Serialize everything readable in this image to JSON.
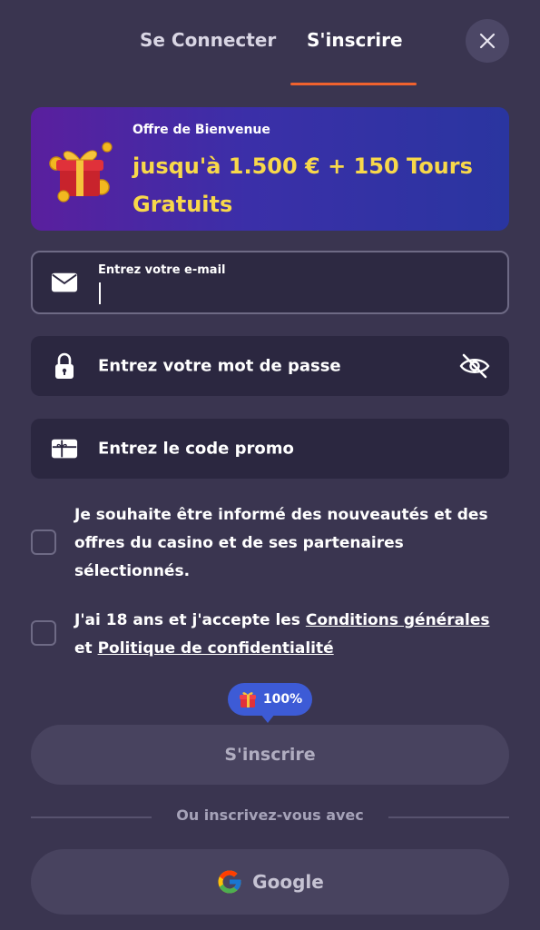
{
  "tabs": {
    "login": "Se Connecter",
    "signup": "S'inscrire",
    "accent_color": "#f0622e"
  },
  "banner": {
    "subtitle": "Offre de Bienvenue",
    "headline": "jusqu'à 1.500 € + 150 Tours Gratuits",
    "icon": "gift-box-icon"
  },
  "email_field": {
    "label": "Entrez votre e-mail",
    "value": "",
    "icon": "envelope-icon"
  },
  "password_field": {
    "placeholder": "Entrez votre mot de passe",
    "icon": "lock-icon",
    "toggle_icon": "eye-slash-icon"
  },
  "promo_field": {
    "placeholder": "Entrez le code promo",
    "icon": "gift-card-icon"
  },
  "newsletter_checkbox": {
    "text": "Je souhaite être informé des nouveautés et des offres du casino et de ses partenaires sélectionnés.",
    "checked": false
  },
  "terms_checkbox": {
    "prefix": "J'ai 18 ans et j'accepte les ",
    "terms_link": "Conditions générales",
    "middle": " et ",
    "privacy_link": "Politique de confidentialité",
    "checked": false
  },
  "progress_badge": {
    "value": "100%",
    "icon": "gift-icon",
    "color": "#3d5bd6"
  },
  "submit_button": {
    "label": "S'inscrire"
  },
  "divider": {
    "text": "Ou inscrivez-vous avec"
  },
  "google_button": {
    "label": "Google",
    "icon": "google-icon"
  }
}
